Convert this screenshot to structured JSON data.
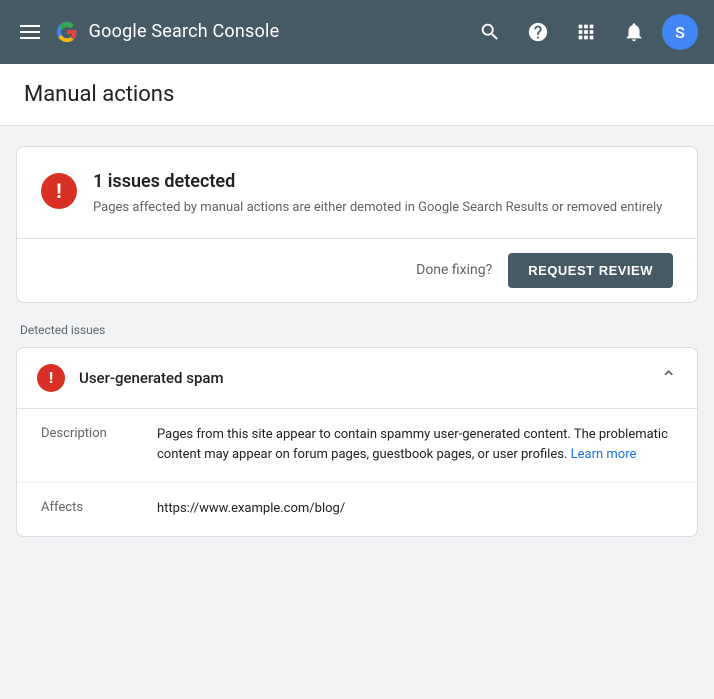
{
  "topnav": {
    "logo_text": "Google Search Console",
    "logo_google": "Google",
    "logo_rest": " Search Console"
  },
  "page_header": {
    "title": "Manual actions"
  },
  "issues_card": {
    "count_title": "1 issues detected",
    "description": "Pages affected by manual actions are either demoted in Google Search Results or removed entirely",
    "done_fixing_label": "Done fixing?",
    "request_review_label": "REQUEST REVIEW"
  },
  "detected_issues": {
    "section_label": "Detected issues",
    "items": [
      {
        "title": "User-generated spam",
        "description": "Pages from this site appear to contain spammy user-generated content. The problematic content may appear on forum pages, guestbook pages, or user profiles.",
        "learn_more_text": "Learn more",
        "affects_label": "Affects",
        "description_label": "Description",
        "affects_url": "https://www.example.com/blog/"
      }
    ]
  },
  "icons": {
    "exclamation": "!",
    "chevron_up": "∧"
  }
}
